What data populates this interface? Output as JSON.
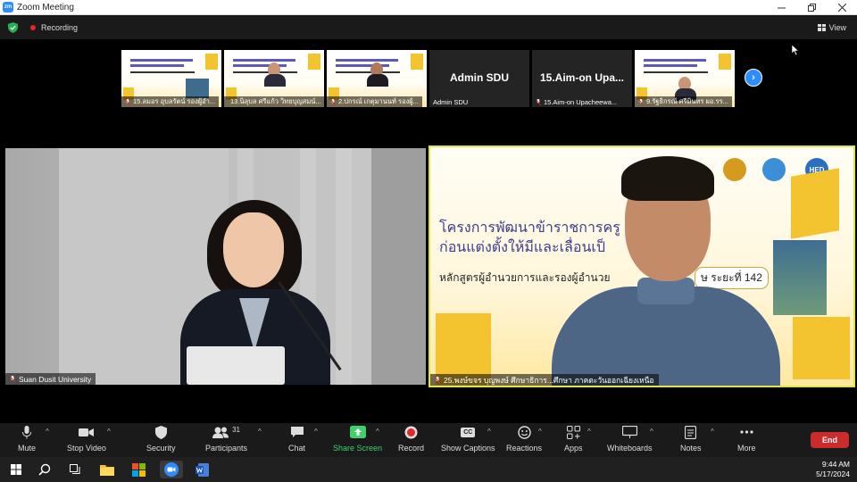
{
  "window": {
    "title": "Zoom Meeting",
    "app_badge": "zm"
  },
  "infobar": {
    "recording_label": "Recording",
    "view_label": "View"
  },
  "thumbnails": [
    {
      "name": "15.ลมอร อุบลรัตน์ รองผู้อำ...",
      "type": "slide"
    },
    {
      "name": "13.นิลุบล ศรีแก้ว วิทยบุญสมน์...",
      "type": "slide-person"
    },
    {
      "name": "2.ปกรณ์ เกตุมานนท์ รองผู้...",
      "type": "slide-person"
    },
    {
      "name": "Admin SDU",
      "type": "name",
      "big": "Admin SDU"
    },
    {
      "name": "15.Aim-on Upacheewa...",
      "type": "name",
      "big": "15.Aim-on Upa..."
    },
    {
      "name": "9.รัฐธิกรณ์ ศรีมินทร ผอ.รร...",
      "type": "slide-person"
    }
  ],
  "main_left": {
    "name": "Suan Dusit University"
  },
  "main_right": {
    "name": "25.พงษ์ขจร บุญพงษ์ ศึกษาธิการ...ศึกษา ภาคตะวันออกเฉียงเหนือ",
    "slide_line1": "โครงการพัฒนาข้าราชการครู                           การศึกษา",
    "slide_line2": "ก่อนแต่งตั้งให้มีและเลื่อนเป็",
    "slide_line3": "หลักสูตรผู้อำนวยการและรองผู้อำนวย",
    "slide_badge": "ษ ระยะที่ 142",
    "logo_text": "HED"
  },
  "toolbar": {
    "mute": "Mute",
    "stop_video": "Stop Video",
    "security": "Security",
    "participants": "Participants",
    "participants_count": "31",
    "chat": "Chat",
    "share_screen": "Share Screen",
    "record": "Record",
    "show_captions": "Show Captions",
    "captions_icon": "CC",
    "reactions": "Reactions",
    "apps": "Apps",
    "whiteboards": "Whiteboards",
    "notes": "Notes",
    "more": "More",
    "end": "End"
  },
  "taskbar": {
    "time": "9:44 AM",
    "date": "5/17/2024"
  },
  "colors": {
    "zoom_blue": "#2D8CFF",
    "end_red": "#cc2b2b",
    "share_green": "#3fd26b",
    "speaker_border": "#e2e24a"
  }
}
